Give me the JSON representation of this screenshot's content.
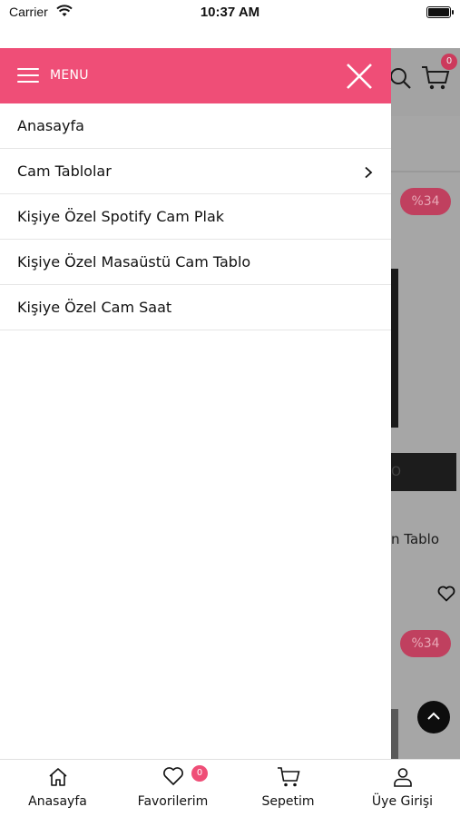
{
  "status_bar": {
    "carrier": "Carrier",
    "time": "10:37 AM"
  },
  "background": {
    "cart_count": "0",
    "discount_badge": "%34",
    "product_title_fragment": "n Tablo",
    "button_fragment": "O",
    "accent_color": "#ef4e77"
  },
  "menu": {
    "title": "MENU",
    "items": [
      {
        "label": "Anasayfa",
        "has_submenu": false
      },
      {
        "label": "Cam Tablolar",
        "has_submenu": true
      },
      {
        "label": "Kişiye Özel Spotify Cam Plak",
        "has_submenu": false
      },
      {
        "label": "Kişiye Özel Masaüstü Cam Tablo",
        "has_submenu": false
      },
      {
        "label": "Kişiye Özel Cam Saat",
        "has_submenu": false
      }
    ]
  },
  "tabbar": {
    "home": "Anasayfa",
    "favorites": "Favorilerim",
    "favorites_count": "0",
    "cart": "Sepetim",
    "account": "Üye Girişi"
  }
}
